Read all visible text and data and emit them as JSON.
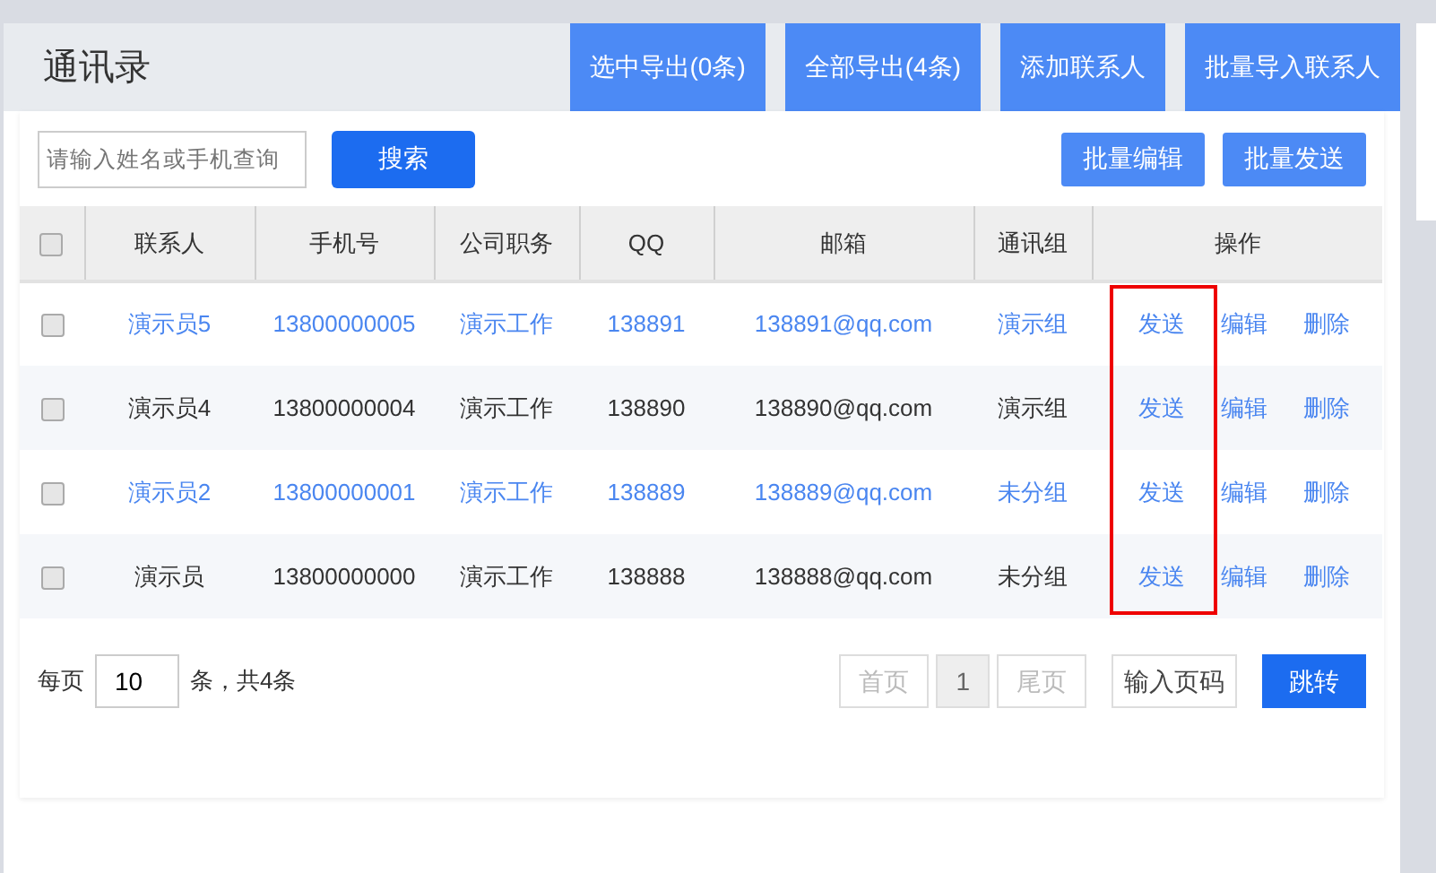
{
  "header": {
    "title": "通讯录",
    "buttons": [
      "选中导出(0条)",
      "全部导出(4条)",
      "添加联系人",
      "批量导入联系人"
    ]
  },
  "search": {
    "placeholder": "请输入姓名或手机查询",
    "button": "搜索"
  },
  "bulk_buttons": [
    "批量编辑",
    "批量发送"
  ],
  "table": {
    "select_all": {
      "checked": false
    },
    "columns": [
      "联系人",
      "手机号",
      "公司职务",
      "QQ",
      "邮箱",
      "通讯组",
      "操作"
    ],
    "rows": [
      {
        "checked": false,
        "color": "#4a86f0",
        "cells": [
          "演示员5",
          "13800000005",
          "演示工作",
          "138891",
          "138891@qq.com",
          "演示组"
        ],
        "actions": [
          "发送",
          "编辑",
          "删除"
        ]
      },
      {
        "checked": false,
        "color": "#333333",
        "cells": [
          "演示员4",
          "13800000004",
          "演示工作",
          "138890",
          "138890@qq.com",
          "演示组"
        ],
        "actions": [
          "发送",
          "编辑",
          "删除"
        ]
      },
      {
        "checked": false,
        "color": "#4a86f0",
        "cells": [
          "演示员2",
          "13800000001",
          "演示工作",
          "138889",
          "138889@qq.com",
          "未分组"
        ],
        "actions": [
          "发送",
          "编辑",
          "删除"
        ]
      },
      {
        "checked": false,
        "color": "#333333",
        "cells": [
          "演示员",
          "13800000000",
          "演示工作",
          "138888",
          "138888@qq.com",
          "未分组"
        ],
        "actions": [
          "发送",
          "编辑",
          "删除"
        ]
      }
    ],
    "annotation": {
      "kind": "box",
      "color": "#ee0000"
    }
  },
  "pagination": {
    "per_page_label": "每页",
    "per_page": "10",
    "total": "条，共4条",
    "first": "首页",
    "pages": [
      {
        "label": "1",
        "selected": true
      }
    ],
    "last": "尾页",
    "page_input_placeholder": "输入页码",
    "go": "跳转"
  }
}
